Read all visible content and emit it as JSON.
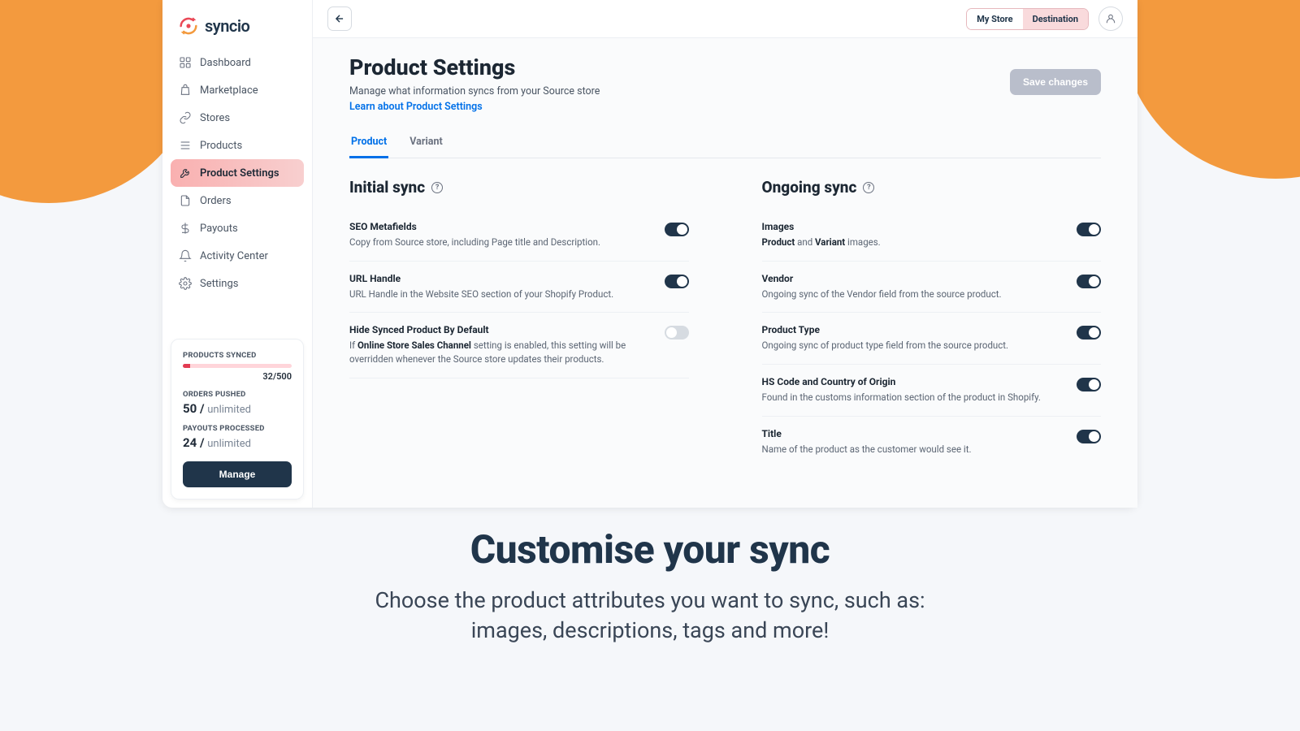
{
  "brand": {
    "name": "syncio"
  },
  "sidebar": {
    "items": [
      {
        "label": "Dashboard"
      },
      {
        "label": "Marketplace"
      },
      {
        "label": "Stores"
      },
      {
        "label": "Products"
      },
      {
        "label": "Product Settings"
      },
      {
        "label": "Orders"
      },
      {
        "label": "Payouts"
      },
      {
        "label": "Activity Center"
      },
      {
        "label": "Settings"
      }
    ],
    "stats": {
      "products_synced_label": "PRODUCTS SYNCED",
      "products_synced_value": "32/500",
      "products_synced_percent": 6.4,
      "orders_label": "ORDERS PUSHED",
      "orders_value": "50 / ",
      "orders_unlimited": "unlimited",
      "payouts_label": "PAYOUTS PROCESSED",
      "payouts_value": "24 / ",
      "payouts_unlimited": "unlimited",
      "manage_label": "Manage"
    }
  },
  "topbar": {
    "my_store": "My Store",
    "destination": "Destination"
  },
  "page": {
    "title": "Product Settings",
    "subtitle": "Manage what information syncs from your Source store",
    "learn_link": "Learn about Product Settings",
    "save_label": "Save changes"
  },
  "tabs": [
    {
      "label": "Product"
    },
    {
      "label": "Variant"
    }
  ],
  "initial_sync": {
    "heading": "Initial sync",
    "items": [
      {
        "title": "SEO Metafields",
        "desc": "Copy from Source store, including Page title and Description.",
        "on": true
      },
      {
        "title": "URL Handle",
        "desc": "URL Handle in the Website SEO section of your Shopify Product.",
        "on": true
      },
      {
        "title": "Hide Synced Product By Default",
        "desc_pre": "If ",
        "desc_bold": "Online Store Sales Channel",
        "desc_post": " setting is enabled, this setting will be overridden whenever the Source store updates their products.",
        "on": false
      }
    ]
  },
  "ongoing_sync": {
    "heading": "Ongoing sync",
    "items": [
      {
        "title": "Images",
        "desc_bold1": "Product",
        "desc_mid": " and ",
        "desc_bold2": "Variant",
        "desc_end": " images.",
        "on": true
      },
      {
        "title": "Vendor",
        "desc": "Ongoing sync of the Vendor field from the source product.",
        "on": true
      },
      {
        "title": "Product Type",
        "desc": "Ongoing sync of product type field from the source product.",
        "on": true
      },
      {
        "title": "HS Code and Country of Origin",
        "desc": "Found in the customs information section of the product in Shopify.",
        "on": true
      },
      {
        "title": "Title",
        "desc": "Name of the product as the customer would see it.",
        "on": true
      }
    ]
  },
  "hero": {
    "title": "Customise your sync",
    "line1": "Choose the product attributes you want to sync, such as:",
    "line2": "images, descriptions, tags and more!"
  }
}
